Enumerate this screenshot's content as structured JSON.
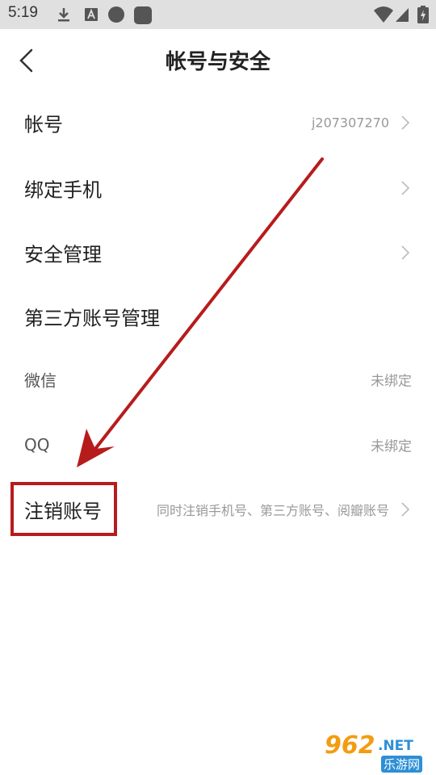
{
  "status_bar": {
    "time": "5:19",
    "icons_left": [
      "download-icon",
      "font-icon",
      "circle-icon",
      "square-icon"
    ],
    "icons_right": [
      "wifi-icon",
      "signal-icon",
      "battery-icon"
    ]
  },
  "header": {
    "title": "帐号与安全",
    "back_icon": "chevron-left-icon"
  },
  "rows": [
    {
      "label": "帐号",
      "value": "j207307270",
      "chevron": true
    },
    {
      "label": "绑定手机",
      "value": "",
      "chevron": true
    },
    {
      "label": "安全管理",
      "value": "",
      "chevron": true
    },
    {
      "label": "第三方账号管理",
      "value": "",
      "chevron": false
    },
    {
      "label": "微信",
      "value": "未绑定",
      "chevron": false
    },
    {
      "label": "QQ",
      "value": "未绑定",
      "chevron": false
    },
    {
      "label": "注销账号",
      "value": "同时注销手机号、第三方账号、阅瓣账号",
      "chevron": true
    }
  ],
  "annotation": {
    "arrow_color": "#b71c1c",
    "box_color": "#b71c1c"
  },
  "watermark": {
    "number": "962",
    "suffix": ".NET",
    "site_name": "乐游网"
  }
}
